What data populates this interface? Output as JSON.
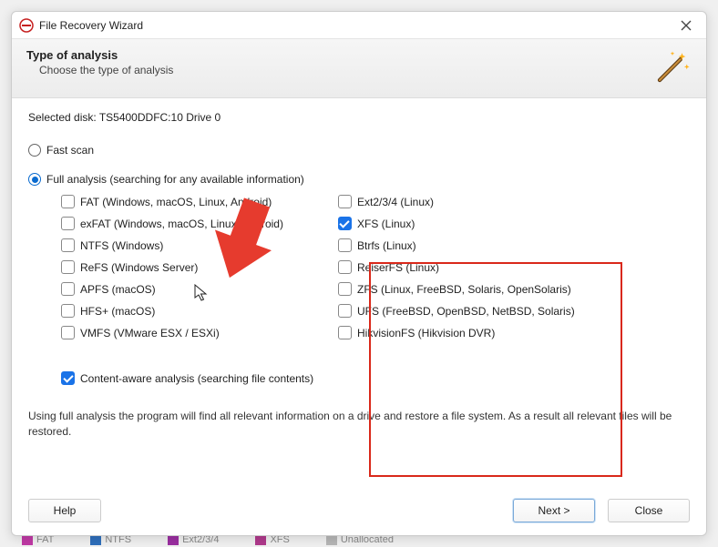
{
  "window": {
    "title": "File Recovery Wizard"
  },
  "header": {
    "title": "Type of analysis",
    "subtitle": "Choose the type of analysis"
  },
  "selected_disk": {
    "prefix": "Selected disk: ",
    "name": "TS5400DDFC:10 Drive 0"
  },
  "scan_options": {
    "fast": {
      "label": "Fast scan",
      "selected": false
    },
    "full": {
      "label": "Full analysis (searching for any available information)",
      "selected": true
    }
  },
  "fs_left": [
    {
      "label": "FAT (Windows, macOS, Linux, Android)",
      "checked": false
    },
    {
      "label": "exFAT (Windows, macOS, Linux, Android)",
      "checked": false
    },
    {
      "label": "NTFS (Windows)",
      "checked": false
    },
    {
      "label": "ReFS (Windows Server)",
      "checked": false
    },
    {
      "label": "APFS (macOS)",
      "checked": false
    },
    {
      "label": "HFS+ (macOS)",
      "checked": false
    },
    {
      "label": "VMFS (VMware ESX / ESXi)",
      "checked": false
    }
  ],
  "fs_right": [
    {
      "label": "Ext2/3/4 (Linux)",
      "checked": false
    },
    {
      "label": "XFS (Linux)",
      "checked": true
    },
    {
      "label": "Btrfs (Linux)",
      "checked": false
    },
    {
      "label": "ReiserFS (Linux)",
      "checked": false
    },
    {
      "label": "ZFS (Linux, FreeBSD, Solaris, OpenSolaris)",
      "checked": false
    },
    {
      "label": "UFS (FreeBSD, OpenBSD, NetBSD, Solaris)",
      "checked": false
    },
    {
      "label": "HikvisionFS (Hikvision DVR)",
      "checked": false
    }
  ],
  "content_aware": {
    "label": "Content-aware analysis (searching file contents)",
    "checked": true
  },
  "description": "Using full analysis the program will find all relevant information on a drive and restore a file system. As a result all relevant files will be restored.",
  "buttons": {
    "help": "Help",
    "next": "Next >",
    "close": "Close"
  },
  "legend": [
    {
      "label": "FAT",
      "color": "#c03aa5"
    },
    {
      "label": "NTFS",
      "color": "#2f6fbb"
    },
    {
      "label": "Ext2/3/4",
      "color": "#9b2fa1"
    },
    {
      "label": "XFS",
      "color": "#b03a8c"
    },
    {
      "label": "Unallocated",
      "color": "#b6b6b6"
    }
  ]
}
